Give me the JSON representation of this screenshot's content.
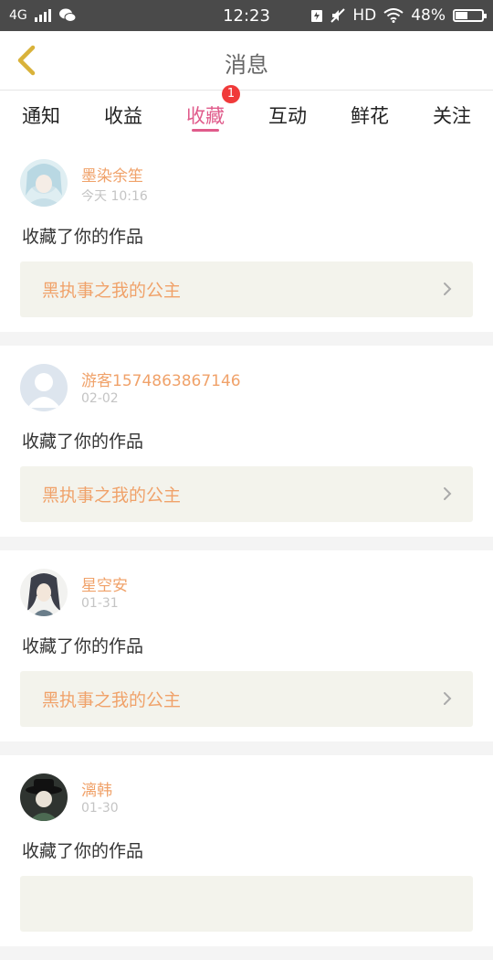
{
  "status_bar": {
    "network": "4G",
    "time": "12:23",
    "hd": "HD",
    "battery": "48%",
    "battery_level": 0.48
  },
  "header": {
    "title": "消息"
  },
  "tabs": [
    {
      "label": "通知"
    },
    {
      "label": "收益"
    },
    {
      "label": "收藏",
      "badge": "1"
    },
    {
      "label": "互动"
    },
    {
      "label": "鲜花"
    },
    {
      "label": "关注"
    }
  ],
  "active_tab": "收藏",
  "messages": [
    {
      "user": "墨染余笙",
      "time": "今天 10:16",
      "action": "收藏了你的作品",
      "work": "黑执事之我的公主",
      "avatar": "avatar-anime-girl-icon"
    },
    {
      "user": "游客1574863867146",
      "time": "02-02",
      "action": "收藏了你的作品",
      "work": "黑执事之我的公主",
      "avatar": "avatar-default-user-icon"
    },
    {
      "user": "星空安",
      "time": "01-31",
      "action": "收藏了你的作品",
      "work": "黑执事之我的公主",
      "avatar": "avatar-anime-dark-hair-icon"
    },
    {
      "user": "漓韩",
      "time": "01-30",
      "action": "收藏了你的作品",
      "work": "",
      "avatar": "avatar-hat-figure-icon"
    }
  ],
  "colors": {
    "accent": "#e05b8b",
    "name": "#f0a26a",
    "back": "#d9b23a"
  }
}
